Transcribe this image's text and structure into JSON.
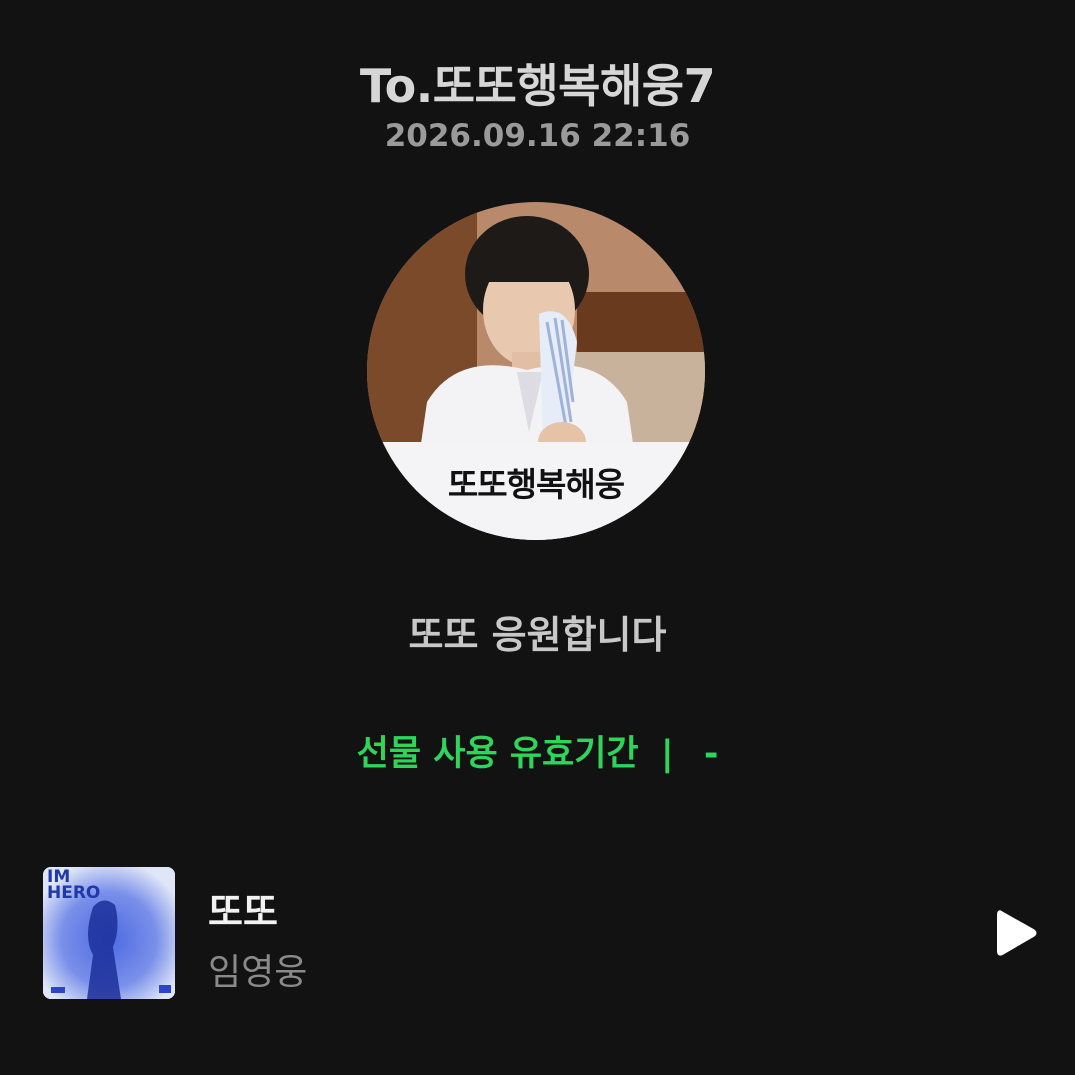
{
  "header": {
    "title": "To.또또행복해웅7",
    "timestamp": "2026.09.16 22:16"
  },
  "profile": {
    "avatar_caption": "또또행복해웅"
  },
  "message": {
    "text": "또또 응원합니다"
  },
  "gift": {
    "validity_label": "선물 사용 유효기간",
    "separator": "|",
    "validity_value": "-",
    "accent_color": "#2fd45a"
  },
  "track": {
    "title": "또또",
    "artist": "임영웅",
    "album_art_text": "IM HERO",
    "play_icon": "play-icon"
  },
  "colors": {
    "background": "#121212",
    "title": "#d6d6d6",
    "timestamp": "#9a9a9a",
    "message": "#c8c8c8",
    "track_title": "#f2f2f2",
    "track_artist": "#8a8a8a"
  }
}
